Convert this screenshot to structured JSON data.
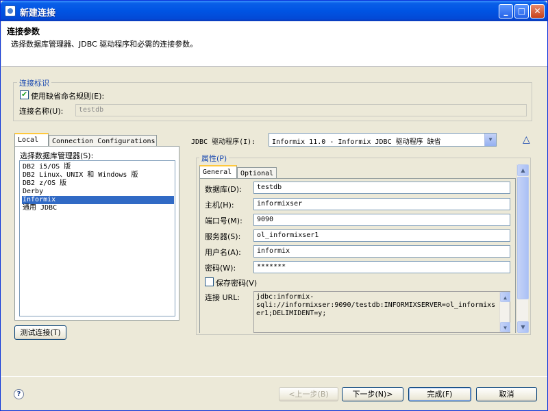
{
  "window": {
    "title": "新建连接",
    "minimize": "_",
    "maximize": "□",
    "close": "✕"
  },
  "header": {
    "title": "连接参数",
    "description": "选择数据库管理器、JDBC 驱动程序和必需的连接参数。"
  },
  "connection_id": {
    "group_label": "连接标识",
    "use_default_label": "使用缺省命名规则(E):",
    "use_default_checked": true,
    "name_label": "连接名称(U):",
    "name_value": "testdb"
  },
  "left_tabs": [
    {
      "label": "Local",
      "active": true
    },
    {
      "label": "Connection Configurations",
      "active": false
    }
  ],
  "db_manager": {
    "label": "选择数据库管理器(S):",
    "items": [
      "DB2 i5/OS 版",
      "DB2 Linux、UNIX 和 Windows 版",
      "DB2 z/OS 版",
      "Derby",
      "Informix",
      "通用 JDBC"
    ],
    "selected_index": 4
  },
  "test_button": "测试连接(T)",
  "jdbc": {
    "label": "JDBC 驱动程序(I):",
    "value": "Informix 11.0 - Informix JDBC 驱动程序 缺省"
  },
  "properties": {
    "group_label": "属性(P)",
    "tabs": [
      {
        "label": "General",
        "active": true
      },
      {
        "label": "Optional",
        "active": false
      }
    ],
    "fields": [
      {
        "label": "数据库(D):",
        "value": "testdb"
      },
      {
        "label": "主机(H):",
        "value": "informixser"
      },
      {
        "label": "端口号(M):",
        "value": "9090"
      },
      {
        "label": "服务器(S):",
        "value": "ol_informixser1"
      },
      {
        "label": "用户名(A):",
        "value": "informix"
      },
      {
        "label": "密码(W):",
        "value": "*******"
      }
    ],
    "save_password_label": "保存密码(V)",
    "save_password_checked": false,
    "url_label": "连接 URL:",
    "url_lines": [
      "jdbc:informix-",
      "sqli://informixser:9090/testdb:INFORMIXSERVER=ol_informixs",
      "er1;DELIMIDENT=y;"
    ]
  },
  "footer": {
    "help": "?",
    "back": "<上一步(B)",
    "next": "下一步(N)>",
    "finish": "完成(F)",
    "cancel": "取消"
  }
}
